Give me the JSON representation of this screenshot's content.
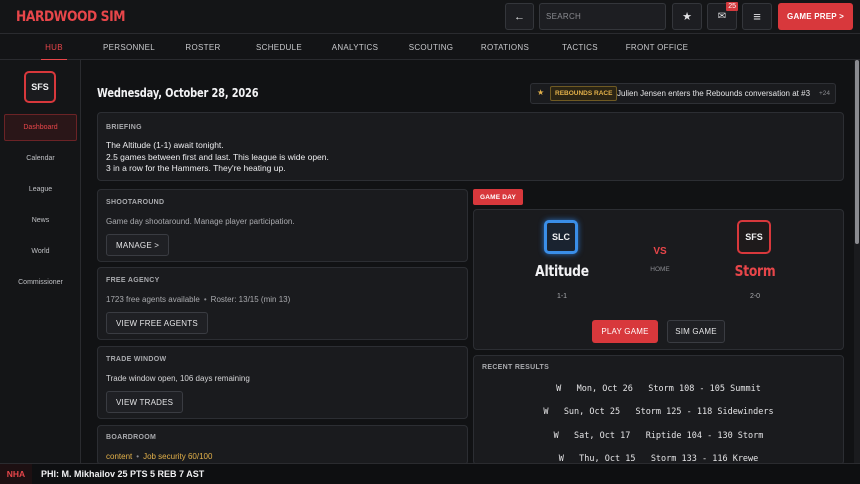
{
  "app": {
    "logo": "HARDWOOD SIM"
  },
  "header": {
    "back_icon": "←",
    "search_placeholder": "SEARCH",
    "star_icon": "★",
    "mail_icon": "✉",
    "mail_badge": "25",
    "menu_icon": "≡",
    "game_prep_label": "GAME PREP >"
  },
  "nav": {
    "tabs": [
      "HUB",
      "PERSONNEL",
      "ROSTER",
      "SCHEDULE",
      "ANALYTICS",
      "SCOUTING",
      "ROTATIONS",
      "TACTICS",
      "FRONT OFFICE"
    ],
    "active": "HUB"
  },
  "sidebar": {
    "team": "SFS",
    "items": [
      "Dashboard",
      "Calendar",
      "League",
      "News",
      "World",
      "Commissioner"
    ],
    "active": "Dashboard"
  },
  "main": {
    "date": "Wednesday, October 28, 2026",
    "ticker": {
      "star": "★",
      "tag": "REBOUNDS RACE",
      "text": "Julien Jensen enters the Rebounds conversation at #3",
      "plus": "+24"
    },
    "briefing": {
      "title": "BRIEFING",
      "lines": [
        "The Altitude (1-1) await tonight.",
        "2.5 games between first and last. This league is wide open.",
        "3 in a row for the Hammers. They're heating up."
      ]
    },
    "shootaround": {
      "title": "SHOOTAROUND",
      "text": "Game day shootaround. Manage player participation.",
      "button": "MANAGE >"
    },
    "free_agency": {
      "title": "FREE AGENCY",
      "text_a": "1723 free agents available",
      "text_b": "Roster: 13/15 (min 13)",
      "button": "VIEW FREE AGENTS"
    },
    "trade_window": {
      "title": "TRADE WINDOW",
      "text": "Trade window open, 106 days remaining",
      "button": "VIEW TRADES"
    },
    "boardroom": {
      "title": "BOARDROOM",
      "status": "content",
      "text": "Job security 60/100"
    },
    "game_day": {
      "tag": "GAME DAY",
      "home": {
        "abbr": "SLC",
        "name": "Altitude",
        "record": "1-1"
      },
      "away": {
        "abbr": "SFS",
        "name": "Storm",
        "record": "2-0"
      },
      "vs": "VS",
      "location": "HOME",
      "play_button": "PLAY GAME",
      "sim_button": "SIM GAME"
    },
    "recent_results": {
      "title": "RECENT RESULTS",
      "rows": [
        "W   Mon, Oct 26   Storm 108 - 105 Summit",
        "W   Sun, Oct 25   Storm 125 - 118 Sidewinders",
        "W   Sat, Oct 17   Riptide 104 - 130 Storm",
        "W   Thu, Oct 15   Storm 133 - 116 Krewe"
      ]
    }
  },
  "bottom_bar": {
    "league": "NHA",
    "ticker": "PHI: M. Mikhailov 25 PTS 5 REB 7 AST"
  },
  "colors": {
    "accent": "#e8464a",
    "home_team": "#3a8ee8",
    "gold": "#e3b14a",
    "background": "#111214"
  }
}
